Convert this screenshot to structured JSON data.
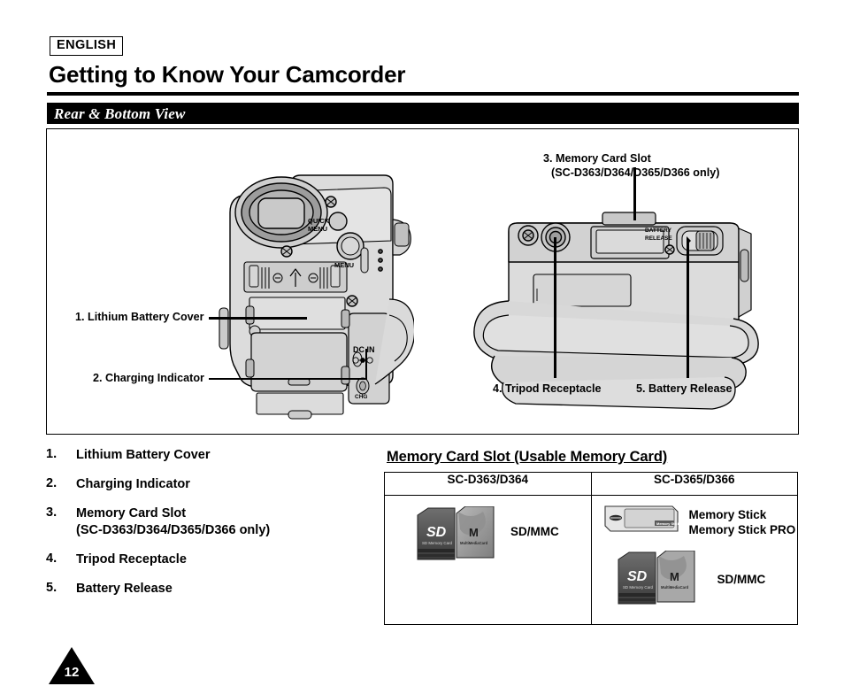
{
  "header": {
    "language_badge": "ENGLISH",
    "title": "Getting to Know Your Camcorder",
    "section_banner": "Rear & Bottom View"
  },
  "diagram": {
    "callouts": [
      {
        "id": "callout-1",
        "text": "1. Lithium Battery Cover"
      },
      {
        "id": "callout-2",
        "text": "2. Charging Indicator"
      },
      {
        "id": "callout-3-line1",
        "text": "3. Memory Card Slot"
      },
      {
        "id": "callout-3-line2",
        "text": "(SC-D363/D364/D365/D366 only)"
      },
      {
        "id": "callout-4",
        "text": "4. Tripod Receptacle"
      },
      {
        "id": "callout-5",
        "text": "5. Battery Release"
      }
    ],
    "rear_view_labels": {
      "quick": "QUICK",
      "quick_menu": "MENU",
      "menu": "MENU",
      "dc_in": "DC IN",
      "chg": "CHG"
    },
    "bottom_view_labels": {
      "battery": "BATTERY",
      "release": "RELEASE"
    }
  },
  "parts_list": [
    {
      "number": "1.",
      "label": "Lithium Battery Cover",
      "sub": ""
    },
    {
      "number": "2.",
      "label": "Charging Indicator",
      "sub": ""
    },
    {
      "number": "3.",
      "label": "Memory Card Slot",
      "sub": "(SC-D363/D364/D365/D366 only)"
    },
    {
      "number": "4.",
      "label": "Tripod Receptacle",
      "sub": ""
    },
    {
      "number": "5.",
      "label": "Battery Release",
      "sub": ""
    }
  ],
  "memory_table": {
    "title": "Memory Card Slot (Usable Memory Card)",
    "columns": [
      "SC-D363/D364",
      "SC-D365/D366"
    ],
    "left_cell": {
      "items": [
        {
          "cards": [
            "sd-card-icon",
            "mmc-card-icon"
          ],
          "label": "SD/MMC"
        }
      ]
    },
    "right_cell": {
      "items": [
        {
          "cards": [
            "memory-stick-icon"
          ],
          "label_line1": "Memory Stick",
          "label_line2": "Memory Stick PRO"
        },
        {
          "cards": [
            "sd-card-icon",
            "mmc-card-icon"
          ],
          "label": "SD/MMC"
        }
      ]
    },
    "card_face_text": {
      "sd_logo": "SD",
      "sd_sub": "SD Memory Card",
      "mmc_logo": "M",
      "mmc_sub": "MultiMediaCard",
      "ms_sub": "Memory Stick"
    }
  },
  "footer": {
    "page_number": "12"
  },
  "colors": {
    "ink": "#000000",
    "paper": "#ffffff",
    "body_gray": "#d9d9d9",
    "mid_gray": "#bfbfbf",
    "dark_gray": "#8a8a8a",
    "eyecup_gray": "#9a9a9a"
  }
}
